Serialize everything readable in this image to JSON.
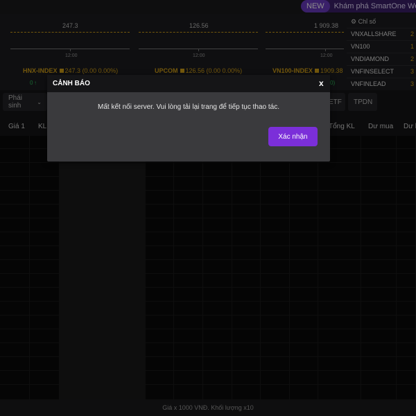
{
  "topbar": {
    "new_label": "NEW",
    "promo_text": "Khám phá SmartOne Web p"
  },
  "panels": [
    {
      "value": "247.3",
      "time": "12:00",
      "name": "",
      "price": "",
      "change": "",
      "sub_left": ""
    },
    {
      "value": "126.56",
      "time": "12:00",
      "name": "HNX-INDEX",
      "price": "247.3",
      "change": "(0.00  0.00%)",
      "sub_left": "0"
    },
    {
      "value": "1 909.38",
      "time": "12:00",
      "name": "UPCOM",
      "price": "126.56",
      "change": "(0.00  0.00%)",
      "sub_left": ""
    },
    {
      "value": "",
      "time": "",
      "name": "VN100-INDEX",
      "price": "1909.38",
      "change": "",
      "sub_left": "0)"
    }
  ],
  "index_list": {
    "header": "Chỉ số",
    "items": [
      {
        "name": "VNXALLSHARE",
        "value": "2"
      },
      {
        "name": "VN100",
        "value": "1"
      },
      {
        "name": "VNDIAMOND",
        "value": "2"
      },
      {
        "name": "VNFINSELECT",
        "value": "3"
      },
      {
        "name": "VNFINLEAD",
        "value": "3"
      }
    ]
  },
  "tabs": {
    "phai_sinh": "Phái sinh",
    "etf": "ETF",
    "tpdn": "TPDN"
  },
  "table_headers": {
    "gia1": "Giá 1",
    "kl": "KL",
    "tong_kl": "Tổng KL",
    "du_mua": "Dư mua",
    "du_ban": "Dư b"
  },
  "footer": "Giá x 1000 VNĐ. Khối lượng x10",
  "modal": {
    "title": "CẢNH BÁO",
    "close": "x",
    "message": "Mất kết nối server. Vui lòng tải lại trang để tiếp tục thao tác.",
    "confirm": "Xác nhận"
  },
  "colors": {
    "accent": "#7b2fd9",
    "index_yellow": "#d4a017"
  }
}
